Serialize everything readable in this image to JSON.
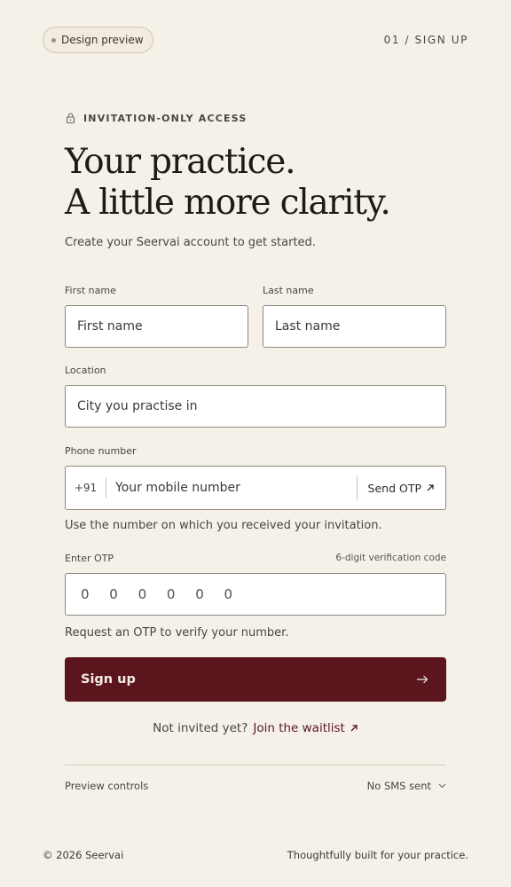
{
  "header": {
    "badge_label": "Design preview",
    "step_label": "01 / SIGN UP"
  },
  "hero": {
    "eyebrow": "INVITATION-ONLY ACCESS",
    "headline_line1": "Your practice.",
    "headline_line2": "A little more clarity.",
    "subtitle": "Create your Seervai account to get started."
  },
  "form": {
    "first_name": {
      "label": "First name",
      "placeholder": "First name"
    },
    "last_name": {
      "label": "Last name",
      "placeholder": "Last name"
    },
    "location": {
      "label": "Location",
      "placeholder": "City you practise in"
    },
    "phone": {
      "label": "Phone number",
      "prefix": "+91",
      "placeholder": "Your mobile number",
      "send_otp_label": "Send OTP",
      "helper": "Use the number on which you received your invitation."
    },
    "otp": {
      "label": "Enter OTP",
      "hint": "6-digit verification code",
      "placeholder": "0 0 0 0 0 0",
      "helper": "Request an OTP to verify your number."
    },
    "submit_label": "Sign up",
    "not_invited_text": "Not invited yet?",
    "waitlist_link": "Join the waitlist"
  },
  "preview_controls": {
    "label": "Preview controls",
    "selected": "No SMS sent"
  },
  "footer": {
    "copyright": "© 2026 Seervai",
    "tagline": "Thoughtfully built for your practice."
  },
  "colors": {
    "background": "#f5f1e8",
    "accent": "#5a151d",
    "input_border": "#8f8a80"
  },
  "icons": [
    "lock-icon",
    "arrow-up-right-icon",
    "arrow-right-icon",
    "chevron-down-icon"
  ]
}
